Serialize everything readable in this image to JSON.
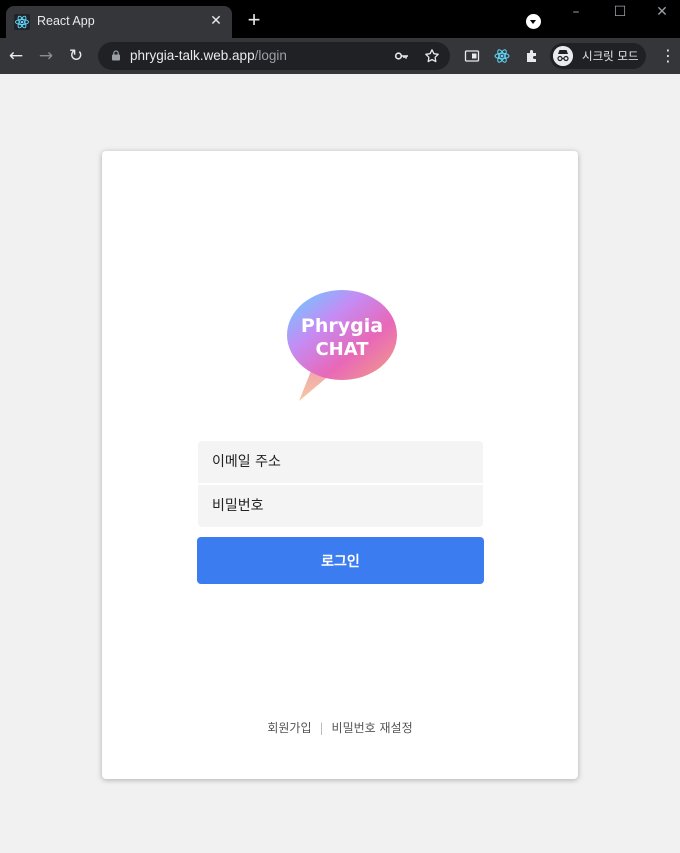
{
  "browser": {
    "tab_title": "React App",
    "url_host": "phrygia-talk.web.app",
    "url_path": "/login",
    "incognito_label": "시크릿 모드",
    "icons": [
      "react-favicon",
      "close-icon",
      "plus-icon",
      "tab-search-icon",
      "minimize-icon",
      "maximize-icon",
      "window-close-icon",
      "back-arrow-icon",
      "forward-arrow-icon",
      "reload-icon",
      "lock-icon",
      "key-icon",
      "star-icon",
      "tab-groups-icon",
      "react-devtools-icon",
      "extensions-puzzle-icon",
      "incognito-icon",
      "more-menu-icon"
    ]
  },
  "logo": {
    "line1": "Phrygia",
    "line2": "CHAT"
  },
  "form": {
    "email_placeholder": "이메일 주소",
    "password_placeholder": "비밀번호",
    "login_label": "로그인"
  },
  "links": {
    "signup": "회원가입",
    "separator": "|",
    "reset_password": "비밀번호 재설정"
  },
  "colors": {
    "accent": "#3b7cf0",
    "background": "#f1f1f1",
    "card": "#ffffff",
    "field": "#f4f4f4"
  }
}
